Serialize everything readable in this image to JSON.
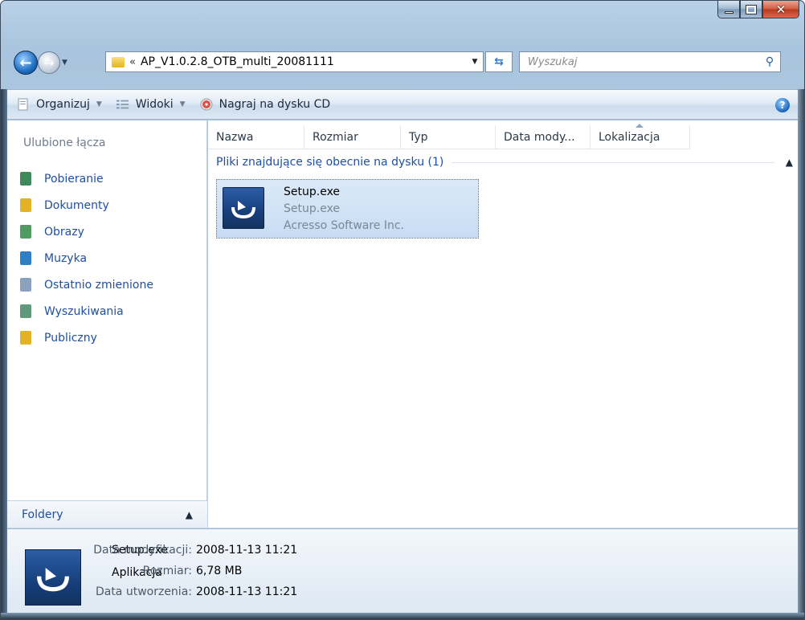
{
  "address": {
    "chevron": "«",
    "path": "AP_V1.0.2.8_OTB_multi_20081111"
  },
  "search": {
    "placeholder": "Wyszukaj"
  },
  "toolbar": {
    "organize_label": "Organizuj",
    "views_label": "Widoki",
    "burn_label": "Nagraj na dysku CD"
  },
  "sidebar": {
    "heading": "Ulubione łącza",
    "items": [
      {
        "label": "Pobieranie",
        "icon": "downloads-icon",
        "color": "#3d8b5a"
      },
      {
        "label": "Dokumenty",
        "icon": "documents-icon",
        "color": "#e4b325"
      },
      {
        "label": "Obrazy",
        "icon": "pictures-icon",
        "color": "#4f9b63"
      },
      {
        "label": "Muzyka",
        "icon": "music-icon",
        "color": "#2f7fc4"
      },
      {
        "label": "Ostatnio zmienione",
        "icon": "recent-icon",
        "color": "#8aa2bd"
      },
      {
        "label": "Wyszukiwania",
        "icon": "searches-icon",
        "color": "#5f9a7d"
      },
      {
        "label": "Publiczny",
        "icon": "public-icon",
        "color": "#e4b325"
      }
    ],
    "folders_label": "Foldery"
  },
  "columns": [
    "Nazwa",
    "Rozmiar",
    "Typ",
    "Data mody...",
    "Lokalizacja"
  ],
  "group": {
    "label": "Pliki znajdujące się obecnie na dysku (1)"
  },
  "file": {
    "name": "Setup.exe",
    "description": "Setup.exe",
    "company": "Acresso Software Inc."
  },
  "details": {
    "name": "Setup.exe",
    "type": "Aplikacja",
    "props": [
      {
        "label": "Data modyfikacji:",
        "value": "2008-11-13 11:21"
      },
      {
        "label": "Rozmiar:",
        "value": "6,78 MB"
      },
      {
        "label": "Data utworzenia:",
        "value": "2008-11-13 11:21"
      }
    ]
  },
  "colors": {
    "link": "#1f4fa0",
    "selection": "#c7dcf3",
    "frame": "#a9c4de"
  }
}
